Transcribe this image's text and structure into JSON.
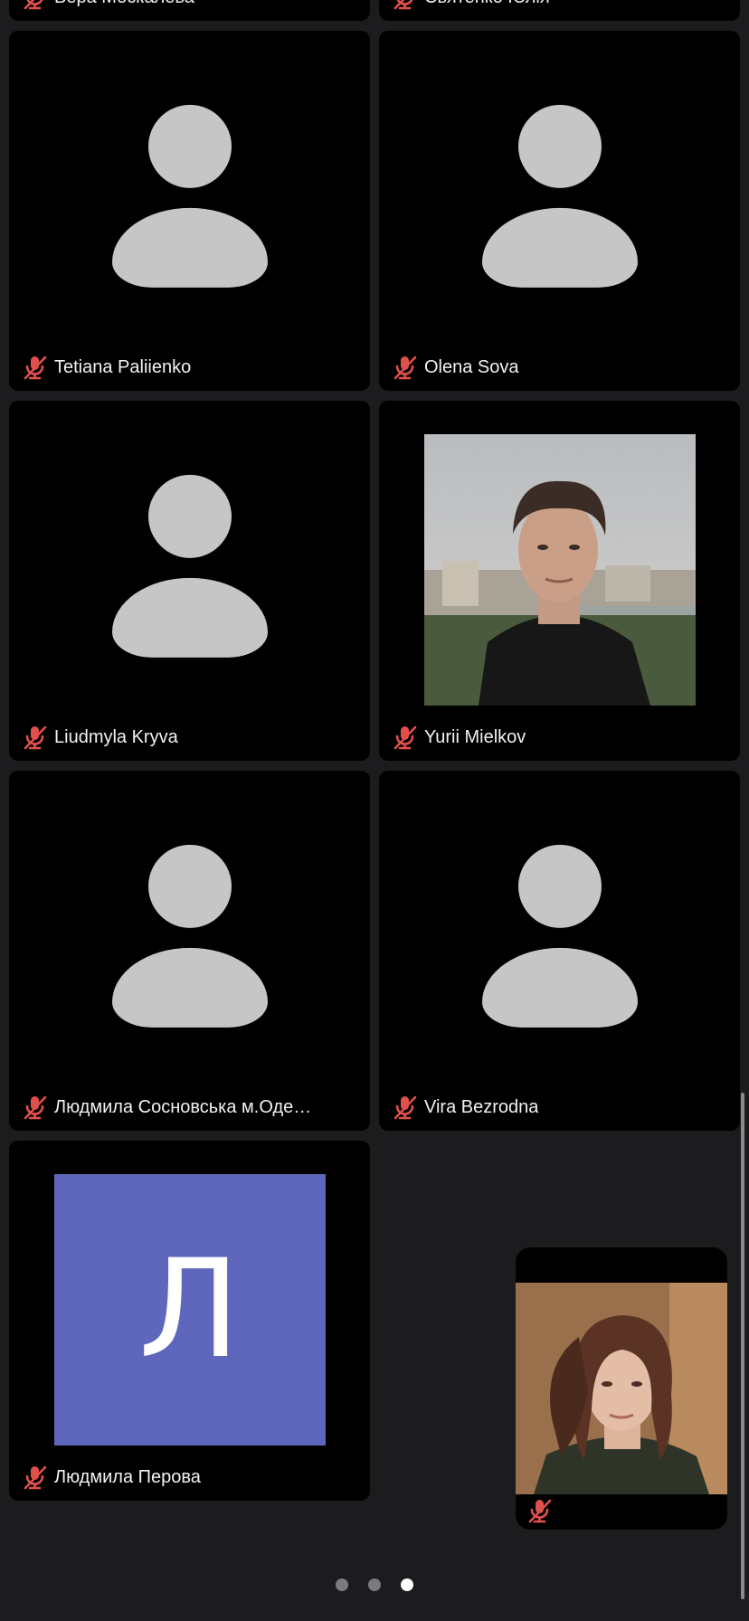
{
  "participants": [
    {
      "name": "Вера Москалева",
      "avatar": "person-placeholder",
      "muted": true
    },
    {
      "name": "Святенко Юлія",
      "avatar": "person-placeholder",
      "muted": true
    },
    {
      "name": "Tetiana Paliienko",
      "avatar": "person-placeholder",
      "muted": true
    },
    {
      "name": "Olena Sova",
      "avatar": "person-placeholder",
      "muted": true
    },
    {
      "name": "Liudmyla Kryva",
      "avatar": "person-placeholder",
      "muted": true
    },
    {
      "name": "Yurii Mielkov",
      "avatar": "photo",
      "muted": true
    },
    {
      "name": "Людмила Сосновська м.Оде…",
      "avatar": "person-placeholder",
      "muted": true
    },
    {
      "name": "Vira Bezrodna",
      "avatar": "person-placeholder",
      "muted": true
    },
    {
      "name": "Людмила Перова",
      "avatar": "letter",
      "avatar_letter": "Л",
      "muted": true
    }
  ],
  "self_view": {
    "muted": true,
    "icon": "mic-off-icon"
  },
  "pagination": {
    "pages": 3,
    "current": 3
  },
  "colors": {
    "background": "#1c1c1e",
    "tile": "#000000",
    "placeholder": "#c6c6c6",
    "mic_muted": "#e0504a",
    "letter_avatar": "#5f67bd",
    "dot_inactive": "#7b7b7e",
    "dot_active": "#ffffff"
  }
}
